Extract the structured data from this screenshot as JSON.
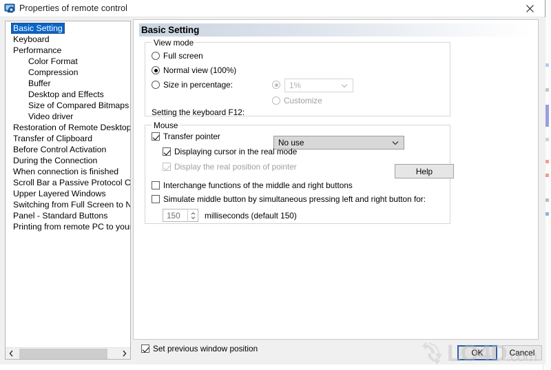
{
  "window": {
    "title": "Properties of remote control",
    "icon": "remote-desktop-gear-icon",
    "close_label": "✕"
  },
  "sidebar": {
    "items": [
      {
        "label": "Basic Setting",
        "indent": 0,
        "selected": true
      },
      {
        "label": "Keyboard",
        "indent": 0,
        "selected": false
      },
      {
        "label": "Performance",
        "indent": 0,
        "selected": false
      },
      {
        "label": "Color Format",
        "indent": 1,
        "selected": false
      },
      {
        "label": "Compression",
        "indent": 1,
        "selected": false
      },
      {
        "label": "Buffer",
        "indent": 1,
        "selected": false
      },
      {
        "label": "Desktop and Effects",
        "indent": 1,
        "selected": false
      },
      {
        "label": "Size of Compared Bitmaps",
        "indent": 1,
        "selected": false
      },
      {
        "label": "Video driver",
        "indent": 1,
        "selected": false
      },
      {
        "label": "Restoration of Remote Desktop",
        "indent": 0,
        "selected": false
      },
      {
        "label": "Transfer of Clipboard",
        "indent": 0,
        "selected": false
      },
      {
        "label": "Before Control Activation",
        "indent": 0,
        "selected": false
      },
      {
        "label": "During the Connection",
        "indent": 0,
        "selected": false
      },
      {
        "label": "When connection is finished",
        "indent": 0,
        "selected": false
      },
      {
        "label": "Scroll Bar a Passive Protocol Control",
        "indent": 0,
        "selected": false
      },
      {
        "label": "Upper Layered Windows",
        "indent": 0,
        "selected": false
      },
      {
        "label": "Switching from Full Screen to Normal",
        "indent": 0,
        "selected": false
      },
      {
        "label": "Panel - Standard Buttons",
        "indent": 0,
        "selected": false
      },
      {
        "label": "Printing from remote PC to your printer",
        "indent": 0,
        "selected": false
      }
    ],
    "scroll_left_icon": "chevron-left-icon",
    "scroll_right_icon": "chevron-right-icon"
  },
  "pane": {
    "header": "Basic Setting",
    "view_mode": {
      "legend": "View mode",
      "option_full_screen": "Full screen",
      "option_normal_view": "Normal view (100%)",
      "option_size_percentage": "Size in percentage:",
      "percent_value": "1%",
      "option_customize": "Customize",
      "f12_label": "Setting the keyboard F12:",
      "f12_value": "No use",
      "chevron_icon": "chevron-down-icon"
    },
    "mouse": {
      "legend": "Mouse",
      "transfer_pointer": "Transfer pointer",
      "displaying_cursor": "Displaying cursor in the real mode",
      "display_real_position": "Display the real position of pointer",
      "interchange_buttons": "Interchange functions of the middle and right buttons",
      "simulate_middle": "Simulate middle button by simultaneous pressing left and right button for:",
      "spin_value": "150",
      "ms_label": "milliseconds (default 150)",
      "help_label": "Help"
    },
    "set_previous_window_position": "Set previous window position"
  },
  "footer": {
    "ok_label": "OK",
    "cancel_label": "Cancel"
  },
  "watermark": {
    "text": "LO4D",
    "domain": ".com",
    "logo_icon": "refresh-circle-arrows-icon"
  }
}
